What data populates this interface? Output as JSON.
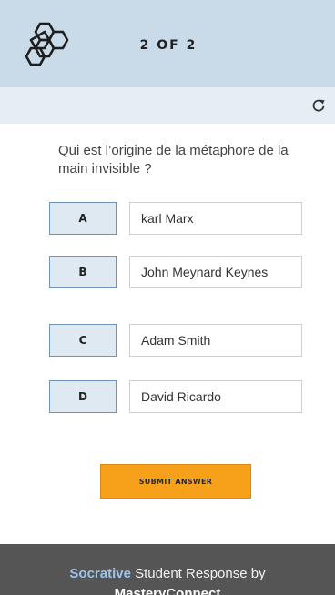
{
  "header": {
    "logo_icon": "hexagon-molecule-icon",
    "progress": "2 OF 2",
    "background": "#c9dae8"
  },
  "toolbar": {
    "refresh_icon": "refresh-icon"
  },
  "question": {
    "text": "Qui est l’origine de la métaphore de la main invisible ?"
  },
  "choices": [
    {
      "letter": "A",
      "text": "karl Marx"
    },
    {
      "letter": "B",
      "text": "John Meynard Keynes"
    },
    {
      "letter": "C",
      "text": "Adam Smith"
    },
    {
      "letter": "D",
      "text": "David Ricardo"
    }
  ],
  "submit": {
    "label": "SUBMIT ANSWER",
    "color": "#f7a11a"
  },
  "footer": {
    "brand": "Socrative",
    "middle": " Student Response by",
    "owner": "MasteryConnect"
  }
}
